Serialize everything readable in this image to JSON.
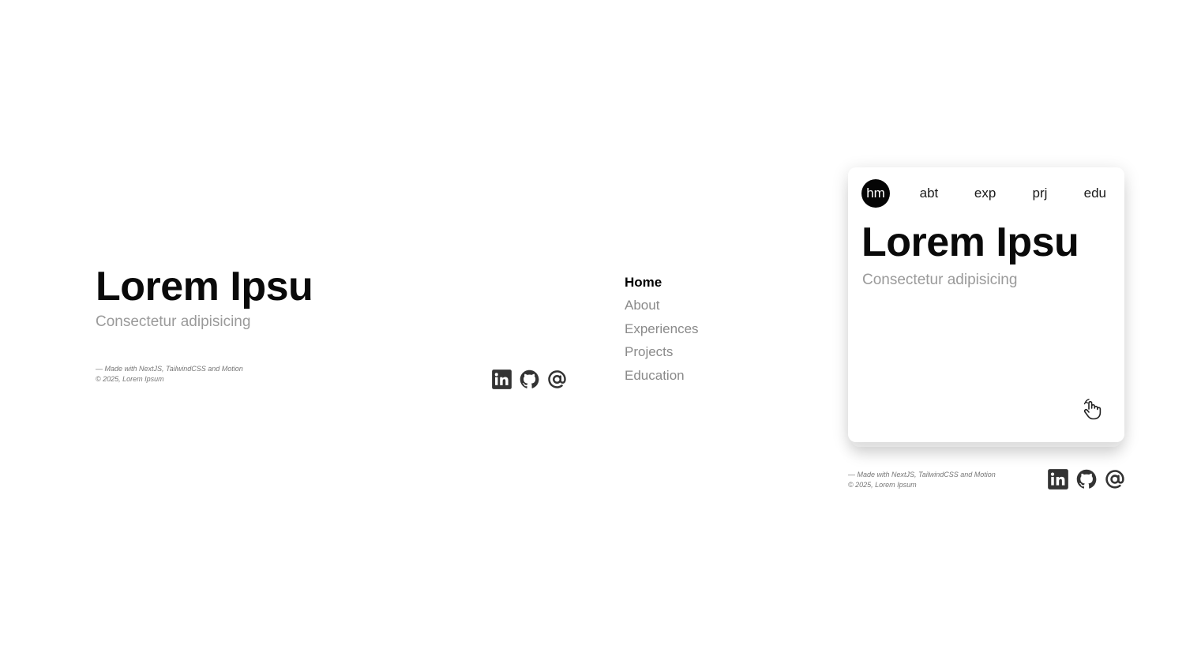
{
  "hero": {
    "title": "Lorem Ipsu",
    "subtitle": "Consectetur adipisicing"
  },
  "footer": {
    "line1": "— Made with NextJS, TailwindCSS and Motion",
    "line2": "© 2025, Lorem Ipsum"
  },
  "socials": [
    "linkedin-icon",
    "github-icon",
    "at-email-icon"
  ],
  "nav": {
    "items": [
      {
        "label": "Home"
      },
      {
        "label": "About"
      },
      {
        "label": "Experiences"
      },
      {
        "label": "Projects"
      },
      {
        "label": "Education"
      }
    ]
  },
  "card": {
    "tabs": [
      {
        "label": "hm"
      },
      {
        "label": "abt"
      },
      {
        "label": "exp"
      },
      {
        "label": "prj"
      },
      {
        "label": "edu"
      }
    ],
    "title": "Lorem Ipsu",
    "subtitle": "Consectetur adipisicing",
    "gesture_icon": "swipe-hand-icon"
  },
  "colors": {
    "text": "#0a0a0a",
    "muted": "#9a9a9a",
    "active_tab_bg": "#050505",
    "icon": "#333333"
  }
}
